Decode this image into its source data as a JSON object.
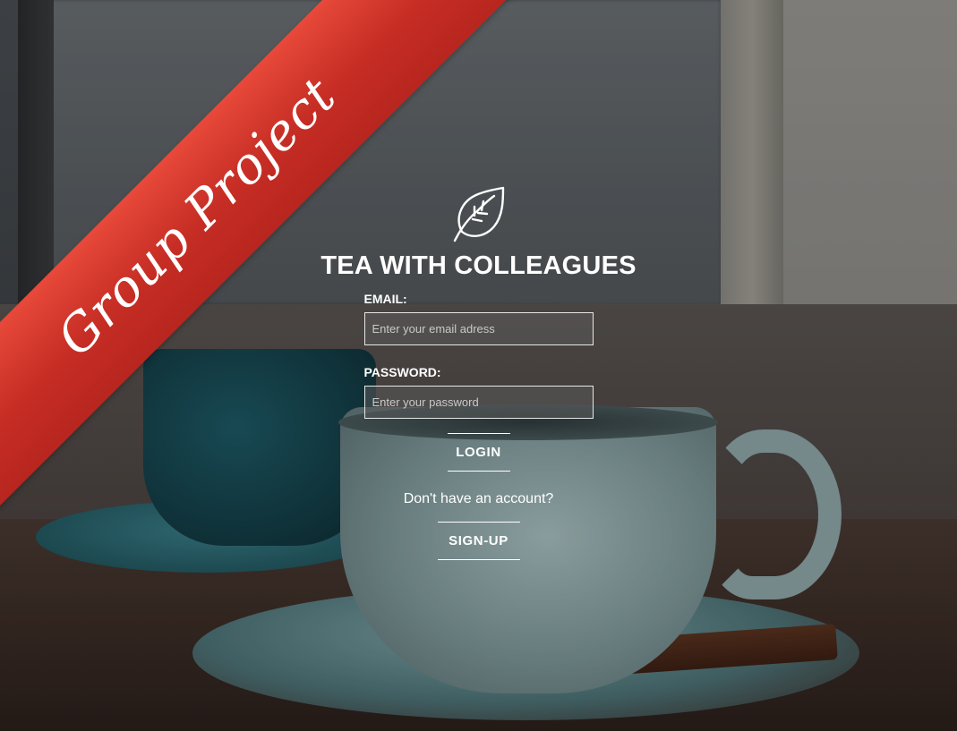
{
  "ribbon": {
    "label": "Group Project"
  },
  "app": {
    "title": "TEA WITH COLLEAGUES",
    "icon": "leaf-icon"
  },
  "form": {
    "email_label": "EMAIL:",
    "email_placeholder": "Enter your email adress",
    "email_value": "",
    "password_label": "PASSWORD:",
    "password_placeholder": "Enter your password",
    "password_value": "",
    "login_label": "LOGIN",
    "no_account_text": "Don't have an account?",
    "signup_label": "SIGN-UP"
  },
  "colors": {
    "ribbon": "#d3352b",
    "text": "#ffffff",
    "input_border": "#e6e6e6"
  }
}
